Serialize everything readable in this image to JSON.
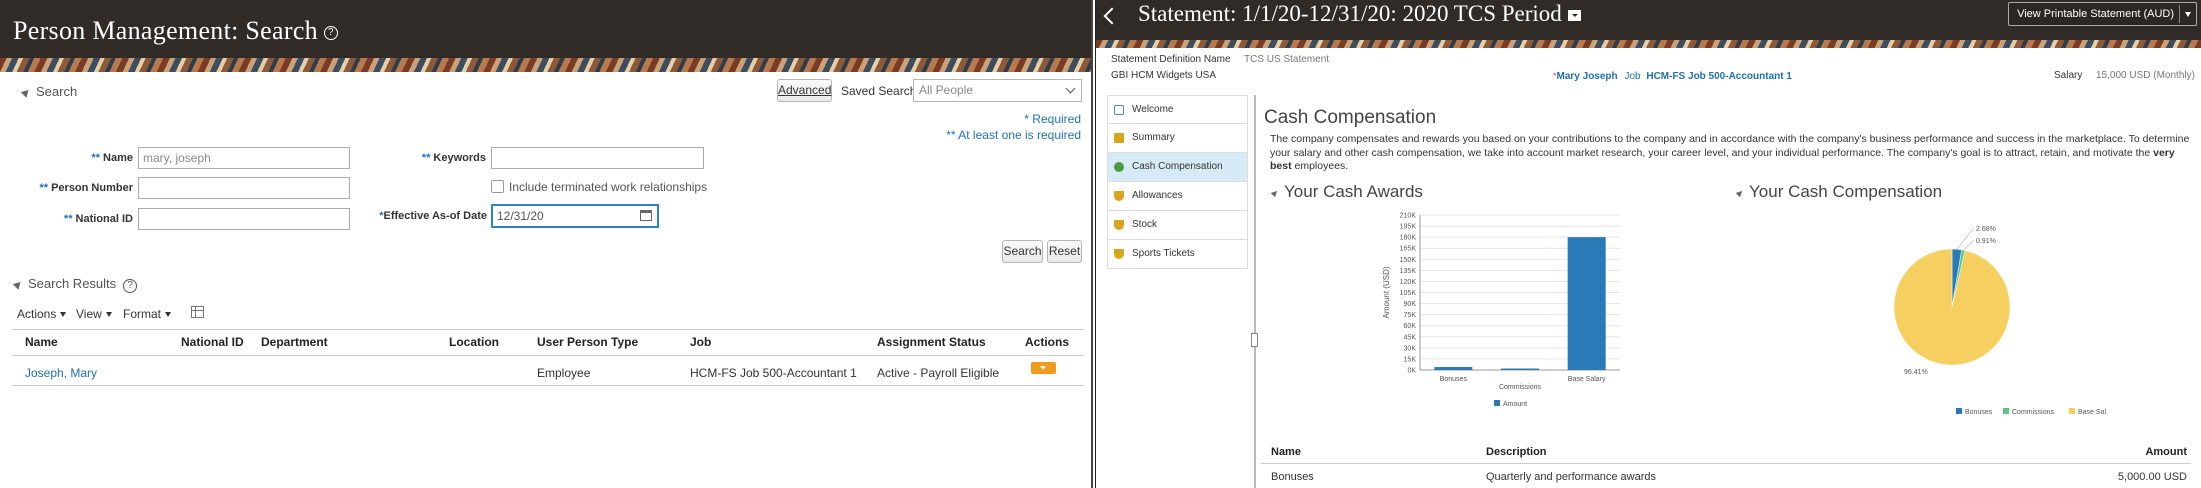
{
  "left": {
    "title": "Person Management: Search",
    "search_label": "Search",
    "advanced_button": "Advanced",
    "saved_search_label": "Saved Search",
    "saved_search_value": "All People",
    "required_note": "* Required",
    "at_least_one_note": "** At least one is required",
    "fields": {
      "name_label": "Name",
      "name_value": "mary, joseph",
      "person_number_label": "Person Number",
      "national_id_label": "National ID",
      "keywords_label": "Keywords",
      "include_terminated_label": "Include terminated work relationships",
      "effective_date_label": "Effective As-of Date",
      "effective_date_value": "12/31/20"
    },
    "search_button": "Search",
    "reset_button": "Reset",
    "results_label": "Search Results",
    "toolbar": {
      "actions": "Actions",
      "view": "View",
      "format": "Format"
    },
    "table": {
      "headers": [
        "Name",
        "National ID",
        "Department",
        "Location",
        "User Person Type",
        "Job",
        "Assignment Status",
        "Actions"
      ],
      "rows": [
        {
          "name": "Joseph, Mary",
          "national_id": "",
          "department": "",
          "location": "",
          "user_person_type": "Employee",
          "job": "HCM-FS Job 500-Accountant 1",
          "assignment_status": "Active - Payroll Eligible"
        }
      ]
    }
  },
  "right": {
    "title": "Statement: 1/1/20-12/31/20: 2020 TCS Period",
    "print_button": "View Printable Statement (AUD)",
    "statement_def_label": "Statement Definition Name",
    "statement_def_value": "TCS US Statement",
    "org": "GBI HCM Widgets USA",
    "person_name": "Mary Joseph",
    "job_label": "Job",
    "job_value": "HCM-FS Job 500-Accountant 1",
    "salary_label": "Salary",
    "salary_value": "15,000 USD (Monthly)",
    "nav": [
      "Welcome",
      "Summary",
      "Cash Compensation",
      "Allowances",
      "Stock",
      "Sports Tickets"
    ],
    "section_title": "Cash Compensation",
    "description_pre": "The company compensates and rewards you based on your contributions to the company and in accordance with the company's business performance and success in the marketplace. To determine your salary and other cash compensation, we take into account market research, your career level, and your individual performance. The company's goal is to attract, retain, and motivate the ",
    "description_bold": "very best",
    "description_post": " employees.",
    "awards_title": "Your Cash Awards",
    "compensation_title": "Your Cash Compensation",
    "table": {
      "headers": [
        "Name",
        "Description",
        "Amount"
      ],
      "rows": [
        {
          "name": "Bonuses",
          "description": "Quarterly and performance awards",
          "amount": "5,000.00 USD"
        }
      ]
    }
  },
  "chart_data": [
    {
      "type": "bar",
      "title": "Your Cash Awards",
      "categories": [
        "Bonuses",
        "Commissions",
        "Base Salary"
      ],
      "series": [
        {
          "name": "Amount",
          "values": [
            4000,
            2000,
            180000
          ]
        }
      ],
      "ylabel": "Amount (USD)",
      "ylim": [
        0,
        210000
      ],
      "yticks": [
        "0K",
        "15K",
        "30K",
        "45K",
        "60K",
        "75K",
        "90K",
        "105K",
        "120K",
        "135K",
        "150K",
        "165K",
        "180K",
        "195K",
        "210K"
      ],
      "color": "#2a7ab8",
      "legend": "bottom"
    },
    {
      "type": "pie",
      "title": "Your Cash Compensation",
      "labels": [
        "Bonuses",
        "Commissions",
        "Base Salary"
      ],
      "values": [
        2.68,
        0.91,
        96.41
      ],
      "data_labels": [
        "2.68%",
        "0.91%",
        "96.41%"
      ],
      "colors": [
        "#2a7ab8",
        "#5cc488",
        "#f5cf5f"
      ],
      "legend": "bottom"
    }
  ]
}
